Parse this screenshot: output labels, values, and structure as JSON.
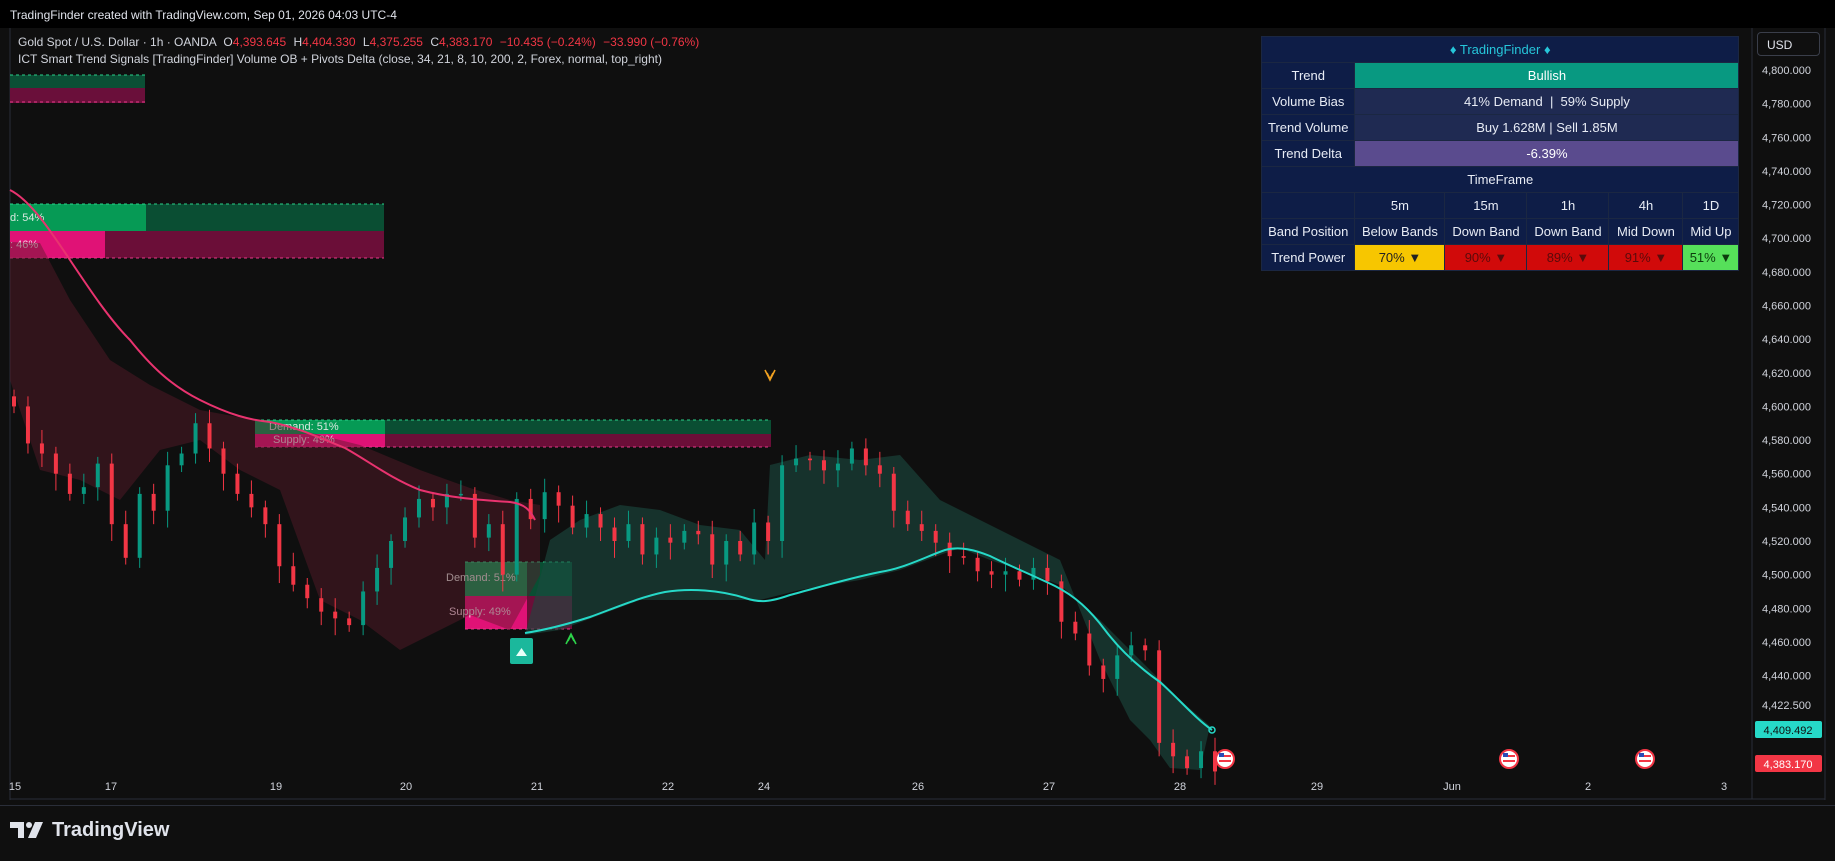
{
  "header": {
    "title": "TradingFinder created with TradingView.com, Sep 01, 2026 04:03 UTC-4"
  },
  "legend": {
    "symbol": "Gold Spot / U.S. Dollar · 1h · OANDA",
    "open": "4,393.645",
    "high": "4,404.330",
    "low": "4,375.255",
    "close": "4,383.170",
    "change": "−10.435 (−0.24%)",
    "change2": "−33.990 (−0.76%)",
    "indicator": "ICT Smart Trend Signals [TradingFinder] Volume OB + Pivots Delta (close, 34, 21, 8, 10, 200, 2, Forex, normal, top_right)"
  },
  "currency": "USD",
  "table": {
    "title": "♦ TradingFinder ♦",
    "trend_label": "Trend",
    "trend_value": "Bullish",
    "bias_label": "Volume Bias",
    "bias_value": "41% Demand  |  59% Supply",
    "volume_label": "Trend Volume",
    "volume_value": "Buy 1.628M | Sell 1.85M",
    "delta_label": "Trend Delta",
    "delta_value": "-6.39%",
    "timeframe_label": "TimeFrame",
    "timeframes": [
      "5m",
      "15m",
      "1h",
      "4h",
      "1D"
    ],
    "band_label": "Band Position",
    "bands": [
      "Below Bands",
      "Down Band",
      "Down Band",
      "Mid Down",
      "Mid Up"
    ],
    "power_label": "Trend Power",
    "powers": [
      "70% ▼",
      "90% ▼",
      "89% ▼",
      "91% ▼",
      "51% ▼"
    ]
  },
  "brand": "TradingView",
  "colors": {
    "bull": "#089981",
    "bear": "#f23645",
    "ma_up": "#26d9c8",
    "ma_down": "#e8336f",
    "demand": "#089a52",
    "supply": "#e0127a"
  },
  "chart_data": {
    "type": "candlestick",
    "x_ticks": [
      "15",
      "17",
      "19",
      "20",
      "21",
      "22",
      "24",
      "26",
      "27",
      "28",
      "29",
      "Jun",
      "2",
      "3"
    ],
    "y_ticks": [
      "4,800.000",
      "4,780.000",
      "4,760.000",
      "4,740.000",
      "4,720.000",
      "4,700.000",
      "4,680.000",
      "4,660.000",
      "4,640.000",
      "4,620.000",
      "4,600.000",
      "4,580.000",
      "4,560.000",
      "4,540.000",
      "4,520.000",
      "4,500.000",
      "4,480.000",
      "4,460.000",
      "4,440.000",
      "4,422.500"
    ],
    "ylim": [
      4375,
      4812
    ],
    "last_price": "4,383.170",
    "ma_price": "4,409.492",
    "series": [
      {
        "name": "price",
        "close": [
          4600,
          4578,
          4572,
          4560,
          4548,
          4552,
          4566,
          4530,
          4510,
          4548,
          4538,
          4565,
          4572,
          4590,
          4575,
          4560,
          4548,
          4540,
          4530,
          4505,
          4494,
          4486,
          4478,
          4474,
          4470,
          4490,
          4504,
          4520,
          4534,
          4545,
          4540,
          4548,
          4548,
          4522,
          4530,
          4500,
          4545,
          4533,
          4549,
          4541,
          4528,
          4536,
          4528,
          4520,
          4530,
          4512,
          4522,
          4519,
          4526,
          4524,
          4506,
          4520,
          4512,
          4531,
          4520,
          4565,
          4569,
          4568,
          4562,
          4566,
          4575,
          4565,
          4560,
          4538,
          4530,
          4526,
          4519,
          4511,
          4510,
          4502,
          4500,
          4502,
          4497,
          4504,
          4496,
          4472,
          4465,
          4446,
          4438,
          4452,
          4458,
          4455,
          4400,
          4392,
          4385,
          4395,
          4383
        ]
      }
    ],
    "zones": [
      {
        "label": "Demand: 51%",
        "type": "demand"
      },
      {
        "label": "Supply: 49%",
        "type": "supply"
      },
      {
        "label": "Demand: 51%",
        "type": "demand"
      },
      {
        "label": "Supply: 49%",
        "type": "supply"
      },
      {
        "label": "d: 54%",
        "type": "demand"
      },
      {
        "label": ": 46%",
        "type": "supply"
      }
    ]
  }
}
